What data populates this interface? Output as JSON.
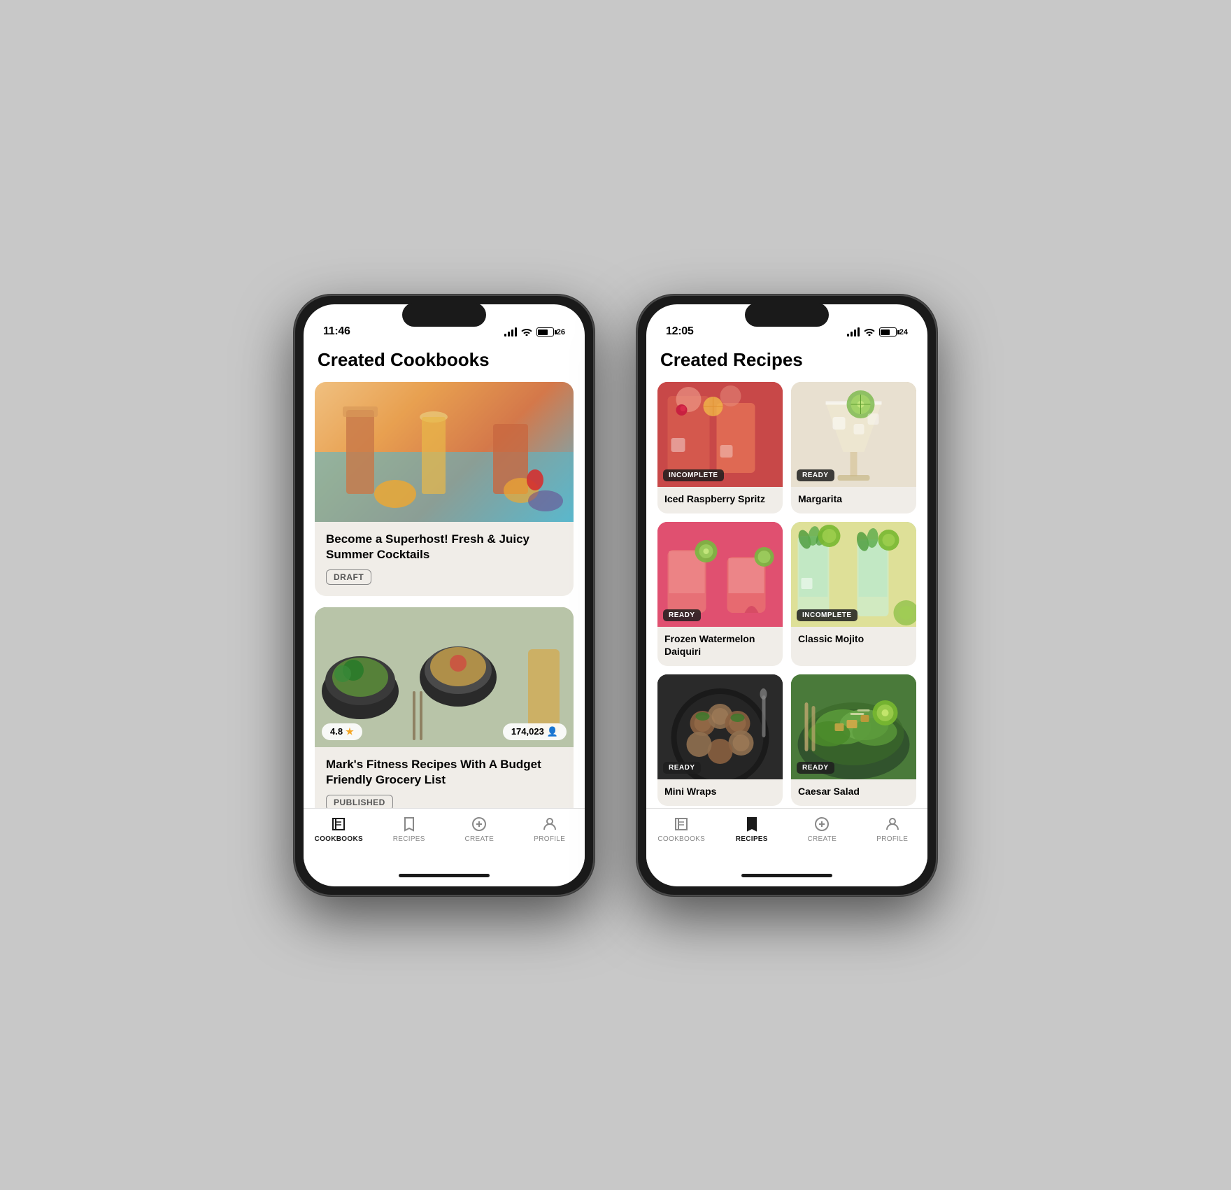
{
  "phones": [
    {
      "id": "phone-left",
      "statusBar": {
        "time": "11:46",
        "battery": "26"
      },
      "pageTitle": "Created Cookbooks",
      "cookbooks": [
        {
          "id": "cookbook-1",
          "title": "Become a Superhost! Fresh & Juicy Summer Cocktails",
          "status": "DRAFT",
          "statusType": "draft",
          "imageType": "cocktails-summer",
          "hasRating": false
        },
        {
          "id": "cookbook-2",
          "title": "Mark's Fitness Recipes With A Budget Friendly Grocery List",
          "status": "PUBLISHED",
          "statusType": "published",
          "imageType": "fitness",
          "hasRating": true,
          "rating": "4.8",
          "followers": "174,023"
        }
      ],
      "tabBar": {
        "items": [
          {
            "id": "cookbooks",
            "label": "COOKBOOKS",
            "icon": "book",
            "active": true
          },
          {
            "id": "recipes",
            "label": "RECIPES",
            "icon": "bookmark",
            "active": false
          },
          {
            "id": "create",
            "label": "CREATE",
            "icon": "plus-circle",
            "active": false
          },
          {
            "id": "profile",
            "label": "PROFILE",
            "icon": "person-circle",
            "active": false
          }
        ]
      }
    },
    {
      "id": "phone-right",
      "statusBar": {
        "time": "12:05",
        "battery": "24"
      },
      "pageTitle": "Created Recipes",
      "recipes": [
        {
          "id": "recipe-1",
          "title": "Iced Raspberry Spritz",
          "status": "INCOMPLETE",
          "statusColor": "dark",
          "imageType": "raspberry"
        },
        {
          "id": "recipe-2",
          "title": "Margarita",
          "status": "READY",
          "statusColor": "dark",
          "imageType": "margarita"
        },
        {
          "id": "recipe-3",
          "title": "Frozen Watermelon Daiquiri",
          "status": "READY",
          "statusColor": "dark",
          "imageType": "watermelon"
        },
        {
          "id": "recipe-4",
          "title": "Classic Mojito",
          "status": "INCOMPLETE",
          "statusColor": "dark",
          "imageType": "mojito"
        },
        {
          "id": "recipe-5",
          "title": "Mini Wraps",
          "status": "READY",
          "statusColor": "dark",
          "imageType": "food1"
        },
        {
          "id": "recipe-6",
          "title": "Caesar Salad",
          "status": "READY",
          "statusColor": "dark",
          "imageType": "salad"
        }
      ],
      "tabBar": {
        "items": [
          {
            "id": "cookbooks",
            "label": "COOKBOOKS",
            "icon": "book",
            "active": false
          },
          {
            "id": "recipes",
            "label": "RECIPES",
            "icon": "bookmark",
            "active": true
          },
          {
            "id": "create",
            "label": "CREATE",
            "icon": "plus-circle",
            "active": false
          },
          {
            "id": "profile",
            "label": "PROFILE",
            "icon": "person-circle",
            "active": false
          }
        ]
      }
    }
  ]
}
